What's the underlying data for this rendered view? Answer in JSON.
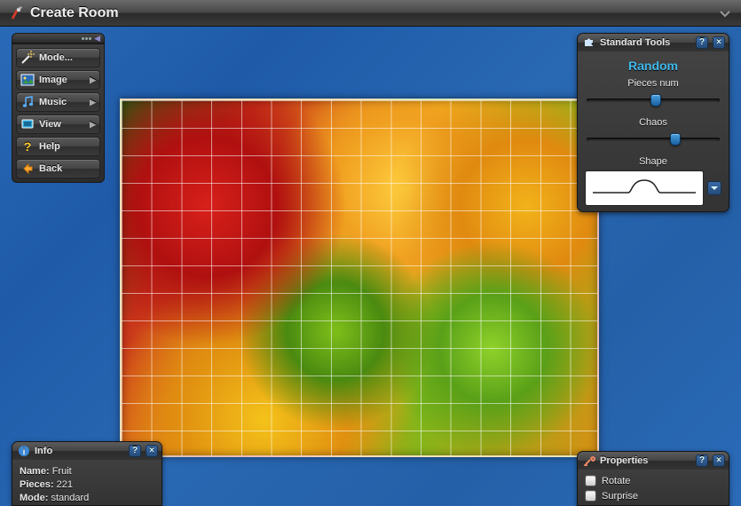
{
  "header": {
    "title": "Create Room"
  },
  "sidebar": {
    "items": [
      {
        "label": "Mode...",
        "icon": "wand",
        "arrow": false
      },
      {
        "label": "Image",
        "icon": "image",
        "arrow": true
      },
      {
        "label": "Music",
        "icon": "music",
        "arrow": true
      },
      {
        "label": "View",
        "icon": "view",
        "arrow": true
      },
      {
        "label": "Help",
        "icon": "help",
        "arrow": false
      },
      {
        "label": "Back",
        "icon": "back",
        "arrow": false
      }
    ]
  },
  "tools": {
    "title": "Standard Tools",
    "heading": "Random",
    "pieces_label": "Pieces num",
    "chaos_label": "Chaos",
    "shape_label": "Shape",
    "pieces_pos_pct": 52,
    "chaos_pos_pct": 68
  },
  "info": {
    "title": "Info",
    "name_label": "Name:",
    "name_value": "Fruit",
    "pieces_label": "Pieces:",
    "pieces_value": "221",
    "mode_label": "Mode:",
    "mode_value": "standard"
  },
  "props": {
    "title": "Properties",
    "rotate_label": "Rotate",
    "surprise_label": "Surprise",
    "rotate_checked": false,
    "surprise_checked": false
  }
}
